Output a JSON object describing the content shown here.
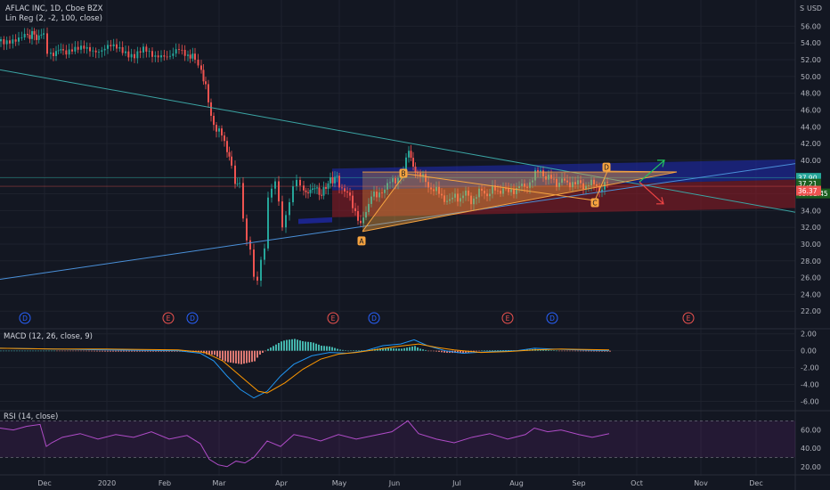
{
  "header": {
    "symbol": "AFLAC INC, 1D, Cboe BZX",
    "indicator": "Lin Reg (2, -2, 100, close)",
    "currency": "USD",
    "scale_mark": "S"
  },
  "colors": {
    "background": "#131722",
    "grid": "#1e222d",
    "up": "#26a69a",
    "down": "#ef5350",
    "trend": "#3ba5a4",
    "blue_zone": "#1f2bb8",
    "red_zone": "#8b1a24",
    "macd_line": "#2196f3",
    "signal_line": "#ff9800",
    "rsi": "#9c27b0",
    "pattern": "#f7a440",
    "arrow_up": "#22c55e",
    "arrow_down": "#ef4444"
  },
  "chart_data": [
    {
      "type": "candlestick",
      "title": "AFLAC INC, 1D, Cboe BZX",
      "x_labels": [
        "Dec",
        "2020",
        "Feb",
        "Mar",
        "Apr",
        "May",
        "Jun",
        "Jul",
        "Aug",
        "Sep",
        "Oct",
        "Nov",
        "Dec"
      ],
      "y_ticks": [
        22,
        24,
        26,
        28,
        30,
        32,
        34,
        36,
        38,
        40,
        42,
        44,
        46,
        48,
        50,
        52,
        54,
        56
      ],
      "ylim": [
        20,
        57
      ],
      "close_path": [
        [
          0,
          54.2
        ],
        [
          10,
          54.5
        ],
        [
          20,
          54.3
        ],
        [
          30,
          54.8
        ],
        [
          35,
          55.1
        ],
        [
          40,
          54.7
        ],
        [
          48,
          55.0
        ],
        [
          52,
          52.8
        ],
        [
          56,
          52.3
        ],
        [
          62,
          53.2
        ],
        [
          70,
          53.0
        ],
        [
          80,
          53.5
        ],
        [
          90,
          53.2
        ],
        [
          100,
          53.0
        ],
        [
          110,
          53.3
        ],
        [
          120,
          53.6
        ],
        [
          130,
          53.2
        ],
        [
          140,
          53.0
        ],
        [
          150,
          52.6
        ],
        [
          160,
          53.0
        ],
        [
          170,
          52.5
        ],
        [
          180,
          52.8
        ],
        [
          190,
          52.2
        ],
        [
          200,
          53.1
        ],
        [
          210,
          52.7
        ],
        [
          218,
          52.0
        ],
        [
          225,
          51.0
        ],
        [
          230,
          48.5
        ],
        [
          236,
          45.5
        ],
        [
          242,
          43.5
        ],
        [
          248,
          43.0
        ],
        [
          254,
          41.5
        ],
        [
          259,
          39.0
        ],
        [
          263,
          37.0
        ],
        [
          268,
          37.5
        ],
        [
          272,
          33.0
        ],
        [
          276,
          31.0
        ],
        [
          280,
          29.5
        ],
        [
          284,
          26.5
        ],
        [
          288,
          25.8
        ],
        [
          292,
          28.0
        ],
        [
          296,
          29.5
        ],
        [
          300,
          35.0
        ],
        [
          304,
          36.5
        ],
        [
          308,
          37.0
        ],
        [
          312,
          35.0
        ],
        [
          316,
          32.0
        ],
        [
          320,
          33.5
        ],
        [
          324,
          35.5
        ],
        [
          328,
          37.0
        ],
        [
          332,
          38.2
        ],
        [
          336,
          37.0
        ],
        [
          340,
          36.5
        ],
        [
          345,
          36.0
        ],
        [
          350,
          36.8
        ],
        [
          355,
          36.5
        ],
        [
          360,
          35.8
        ],
        [
          365,
          37.0
        ],
        [
          370,
          37.5
        ],
        [
          375,
          38.0
        ],
        [
          380,
          37.3
        ],
        [
          386,
          36.2
        ],
        [
          392,
          35.5
        ],
        [
          398,
          34.0
        ],
        [
          404,
          32.0
        ],
        [
          410,
          34.0
        ],
        [
          416,
          36.0
        ],
        [
          422,
          35.5
        ],
        [
          428,
          36.5
        ],
        [
          434,
          37.0
        ],
        [
          440,
          37.5
        ],
        [
          446,
          38.0
        ],
        [
          452,
          38.5
        ],
        [
          458,
          41.5
        ],
        [
          463,
          39.0
        ],
        [
          468,
          38.5
        ],
        [
          474,
          37.8
        ],
        [
          480,
          37.0
        ],
        [
          486,
          36.5
        ],
        [
          492,
          36.0
        ],
        [
          498,
          35.5
        ],
        [
          504,
          35.0
        ],
        [
          510,
          35.8
        ],
        [
          516,
          35.5
        ],
        [
          522,
          36.0
        ],
        [
          528,
          35.2
        ],
        [
          534,
          35.8
        ],
        [
          540,
          36.3
        ],
        [
          546,
          36.0
        ],
        [
          552,
          36.5
        ],
        [
          558,
          36.2
        ],
        [
          564,
          36.8
        ],
        [
          570,
          36.0
        ],
        [
          576,
          36.5
        ],
        [
          582,
          37.0
        ],
        [
          588,
          36.6
        ],
        [
          594,
          37.5
        ],
        [
          600,
          38.3
        ],
        [
          606,
          38.8
        ],
        [
          612,
          38.0
        ],
        [
          618,
          37.7
        ],
        [
          624,
          37.3
        ],
        [
          630,
          37.7
        ],
        [
          636,
          37.0
        ],
        [
          642,
          37.5
        ],
        [
          648,
          37.2
        ],
        [
          654,
          36.8
        ],
        [
          660,
          37.4
        ],
        [
          666,
          37.0
        ],
        [
          672,
          36.6
        ],
        [
          678,
          37.1
        ],
        [
          684,
          37.3
        ]
      ],
      "series": [
        {
          "name": "AFLAC INC",
          "last_value": "37.21",
          "prior_close": "37.90",
          "countdown": "05:01:45"
        },
        {
          "name": "Lin Reg (2, -2, 100, close)",
          "lower_band": "36.37"
        }
      ],
      "pattern_points": [
        {
          "label": "A",
          "x": "May",
          "y": 31.5
        },
        {
          "label": "B",
          "x": "Jun",
          "y": 38.4
        },
        {
          "label": "C",
          "x": "Sep",
          "y": 35.2
        },
        {
          "label": "D",
          "x": "Sep",
          "y": 38.7
        }
      ],
      "events": [
        "D",
        "E",
        "D",
        "E",
        "D",
        "E",
        "D",
        "E"
      ]
    },
    {
      "type": "line",
      "title": "MACD (12, 26, close, 9)",
      "y_ticks": [
        -6.0,
        -4.0,
        -2.0,
        0.0,
        2.0
      ],
      "ylim": [
        -7,
        2.5
      ],
      "x_labels": [
        "Dec",
        "2020",
        "Feb",
        "Mar",
        "Apr",
        "May",
        "Jun",
        "Jul",
        "Aug",
        "Sep",
        "Oct",
        "Nov",
        "Dec"
      ],
      "series": [
        {
          "name": "MACD",
          "values": [
            [
              0,
              0.3
            ],
            [
              60,
              0.2
            ],
            [
              120,
              0.1
            ],
            [
              200,
              0.0
            ],
            [
              225,
              -0.3
            ],
            [
              240,
              -1.2
            ],
            [
              255,
              -3.0
            ],
            [
              270,
              -4.6
            ],
            [
              285,
              -5.6
            ],
            [
              300,
              -4.8
            ],
            [
              315,
              -3.0
            ],
            [
              330,
              -1.6
            ],
            [
              350,
              -0.6
            ],
            [
              370,
              -0.2
            ],
            [
              390,
              -0.3
            ],
            [
              410,
              0.0
            ],
            [
              430,
              0.6
            ],
            [
              450,
              0.8
            ],
            [
              465,
              1.3
            ],
            [
              480,
              0.6
            ],
            [
              500,
              0.0
            ],
            [
              520,
              -0.3
            ],
            [
              550,
              -0.1
            ],
            [
              580,
              0.0
            ],
            [
              600,
              0.3
            ],
            [
              620,
              0.2
            ],
            [
              650,
              0.1
            ],
            [
              684,
              0.0
            ]
          ]
        },
        {
          "name": "Signal",
          "values": [
            [
              0,
              0.3
            ],
            [
              60,
              0.2
            ],
            [
              120,
              0.2
            ],
            [
              200,
              0.1
            ],
            [
              230,
              -0.2
            ],
            [
              250,
              -1.2
            ],
            [
              270,
              -3.0
            ],
            [
              290,
              -4.8
            ],
            [
              300,
              -5.0
            ],
            [
              320,
              -3.8
            ],
            [
              340,
              -2.2
            ],
            [
              360,
              -1.0
            ],
            [
              380,
              -0.4
            ],
            [
              400,
              -0.2
            ],
            [
              420,
              0.1
            ],
            [
              445,
              0.5
            ],
            [
              470,
              0.8
            ],
            [
              490,
              0.4
            ],
            [
              510,
              0.1
            ],
            [
              540,
              -0.2
            ],
            [
              570,
              -0.1
            ],
            [
              600,
              0.1
            ],
            [
              630,
              0.2
            ],
            [
              684,
              0.1
            ]
          ]
        }
      ]
    },
    {
      "type": "line",
      "title": "RSI (14, close)",
      "y_ticks": [
        20.0,
        40.0,
        60.0
      ],
      "ylim": [
        12,
        80
      ],
      "x_labels": [
        "Dec",
        "2020",
        "Feb",
        "Mar",
        "Apr",
        "May",
        "Jun",
        "Jul",
        "Aug",
        "Sep",
        "Oct",
        "Nov",
        "Dec"
      ],
      "series": [
        {
          "name": "RSI",
          "values": [
            [
              0,
              62
            ],
            [
              15,
              60
            ],
            [
              30,
              64
            ],
            [
              45,
              66
            ],
            [
              52,
              42
            ],
            [
              58,
              46
            ],
            [
              70,
              52
            ],
            [
              90,
              56
            ],
            [
              110,
              50
            ],
            [
              130,
              55
            ],
            [
              150,
              52
            ],
            [
              170,
              58
            ],
            [
              190,
              50
            ],
            [
              210,
              54
            ],
            [
              225,
              45
            ],
            [
              235,
              28
            ],
            [
              245,
              22
            ],
            [
              255,
              20
            ],
            [
              265,
              26
            ],
            [
              275,
              24
            ],
            [
              285,
              30
            ],
            [
              300,
              48
            ],
            [
              315,
              42
            ],
            [
              330,
              55
            ],
            [
              345,
              52
            ],
            [
              360,
              48
            ],
            [
              380,
              55
            ],
            [
              400,
              50
            ],
            [
              420,
              54
            ],
            [
              440,
              58
            ],
            [
              458,
              70
            ],
            [
              470,
              56
            ],
            [
              490,
              50
            ],
            [
              510,
              46
            ],
            [
              530,
              52
            ],
            [
              550,
              56
            ],
            [
              570,
              50
            ],
            [
              590,
              55
            ],
            [
              600,
              62
            ],
            [
              615,
              58
            ],
            [
              630,
              60
            ],
            [
              650,
              55
            ],
            [
              665,
              52
            ],
            [
              684,
              56
            ]
          ]
        }
      ]
    }
  ]
}
